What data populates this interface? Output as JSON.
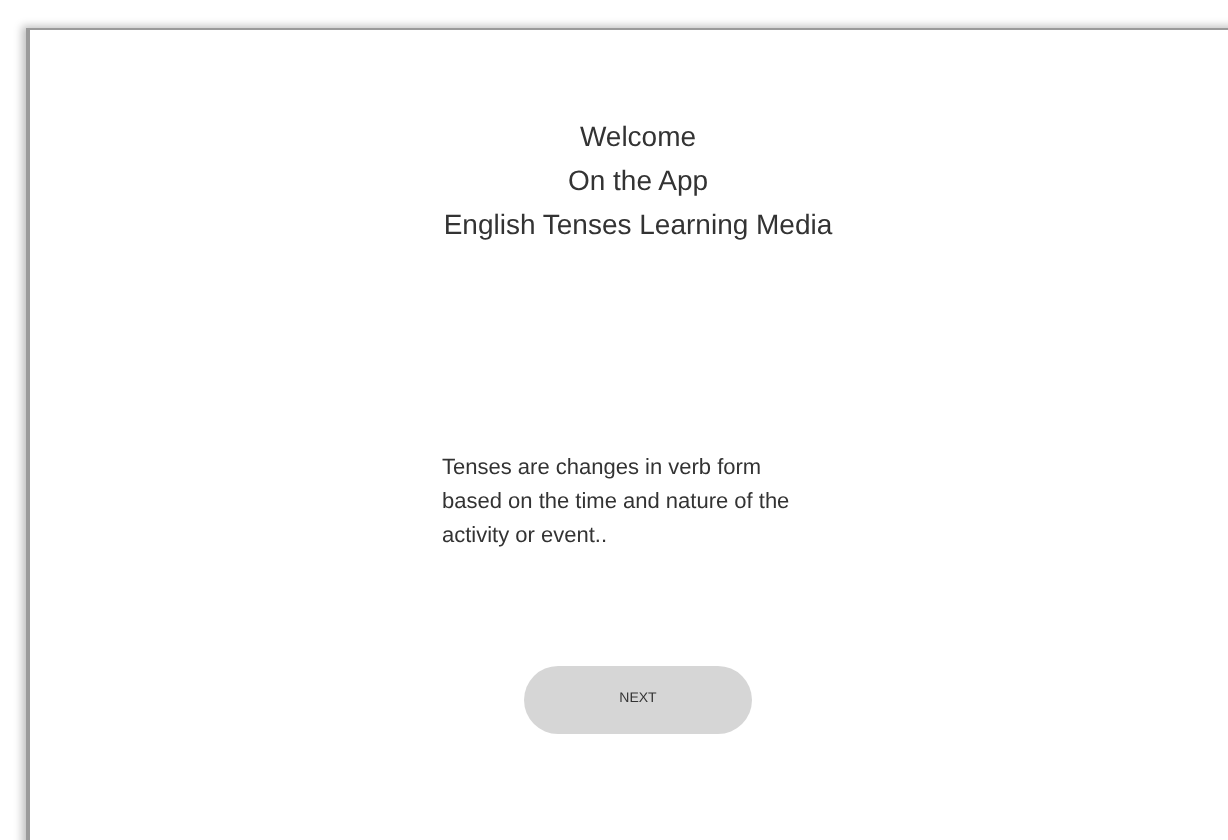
{
  "title_lines": [
    "Welcome",
    "On the App",
    "English Tenses Learning Media"
  ],
  "description": "Tenses are changes in verb form based on the time and nature of the activity or event..",
  "button": {
    "label": "NEXT"
  }
}
